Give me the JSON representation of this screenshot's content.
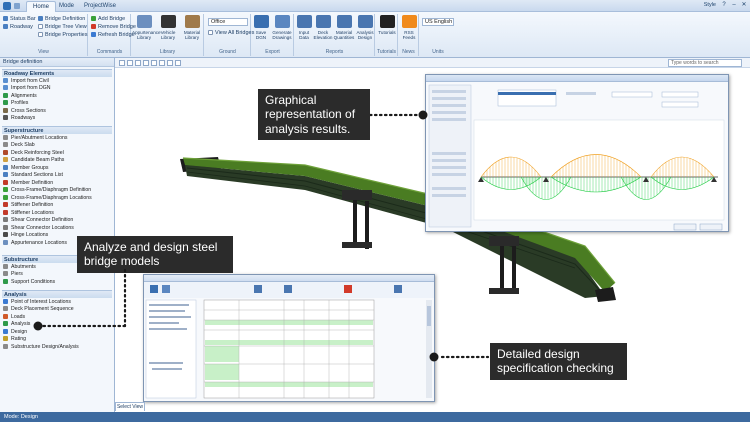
{
  "titlebar": {
    "tabs": [
      "Home",
      "Mode",
      "ProjectWise"
    ],
    "style_label": "Style",
    "window_buttons": [
      "?",
      "–",
      "✕"
    ]
  },
  "ribbon": {
    "view_group": {
      "label": "View",
      "items": [
        "Status Bar",
        "Roadway",
        "Bridge Definition",
        "Bridge Tree View",
        "Bridge Properties"
      ]
    },
    "commands_group": {
      "label": "Commands",
      "items": [
        "Add Bridge",
        "Remove Bridge",
        "Refresh Bridge"
      ]
    },
    "libraries_group": {
      "label": "Library",
      "buttons": [
        "Appurtenance Library",
        "Vehicle Library",
        "Material Library"
      ]
    },
    "ground_group": {
      "label": "Ground",
      "dropdown_value": "Office",
      "checkbox": "View All Bridges"
    },
    "export_group": {
      "label": "Export",
      "buttons": [
        "Save DGN",
        "Generate Drawings"
      ]
    },
    "reports_group": {
      "label": "Reports",
      "buttons": [
        "Input Data",
        "Deck Elevation",
        "Material Quantities",
        "Analysis Design"
      ]
    },
    "tutorials_group": {
      "label": "Tutorials",
      "button": "Tutorials"
    },
    "news_group": {
      "label": "News",
      "button": "RSS Feeds"
    },
    "units_group": {
      "label": "Units",
      "dropdown_value": "US English"
    }
  },
  "toolbar": {
    "search_placeholder": "Type words to search"
  },
  "panel": {
    "title": "Bridge definition",
    "sections": [
      {
        "heading": "Roadway Elements",
        "items": [
          "Import from Civil",
          "Import from DGN",
          "Alignments",
          "Profiles",
          "Cross Sections",
          "Roadways"
        ]
      },
      {
        "heading": "Superstructure",
        "items": [
          "Pier/Abutment Locations",
          "Deck Slab",
          "Deck Reinforcing Steel",
          "Candidate Beam Paths",
          "Member Groups",
          "Standard Sections List",
          "Member Definition",
          "Cross-Frame/Diaphragm Definition",
          "Cross-Frame/Diaphragm Locations",
          "Stiffener Definition",
          "Stiffener Locations",
          "Shear Connector Definition",
          "Shear Connector Locations",
          "Hinge Locations",
          "Appurtenance Locations"
        ]
      },
      {
        "heading": "Substructure",
        "items": [
          "Abutments",
          "Piers",
          "Support Conditions"
        ]
      },
      {
        "heading": "Analysis",
        "items": [
          "Point of Interest Locations",
          "Deck Placement Sequence",
          "Loads",
          "Analysis",
          "Design",
          "Rating",
          "Substructure Design/Analysis"
        ]
      }
    ]
  },
  "view_tab": "Select View",
  "statusbar": "Mode: Design",
  "callouts": {
    "graphical": "Graphical representation of analysis results.",
    "analyze": "Analyze and design steel  bridge models",
    "detailed": "Detailed design specification checking"
  },
  "colors": {
    "callout_bg": "#2b2b2b",
    "deck": "#3f6f1f",
    "girder": "#2d3a2d",
    "diagram_green": "#22cc44",
    "diagram_orange": "#f0a020",
    "table_green": "#c8f0c8"
  }
}
